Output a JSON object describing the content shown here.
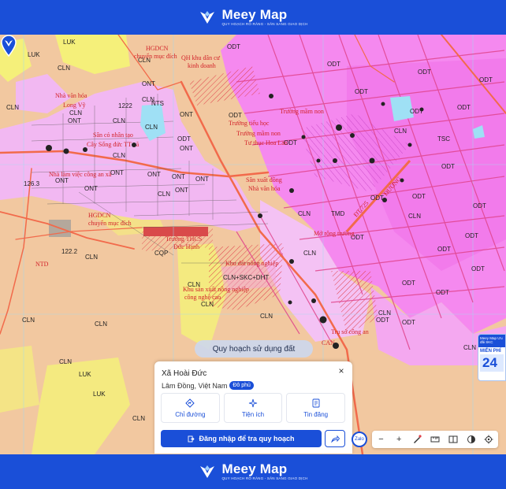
{
  "brand": {
    "name": "Meey Map",
    "tagline": "QUY HOẠCH RÕ RÀNG - SĂN SANG GIAO DỊCH"
  },
  "map": {
    "labels_black": [
      {
        "t": "LUK"
      },
      {
        "t": "ODT"
      },
      {
        "t": "CLN"
      },
      {
        "t": "LUK"
      },
      {
        "t": "CLN"
      },
      {
        "t": "CLN"
      },
      {
        "t": "ONT"
      },
      {
        "t": "CLN"
      },
      {
        "t": "ONT"
      },
      {
        "t": "CLN"
      },
      {
        "t": "ONT"
      },
      {
        "t": "CLN"
      },
      {
        "t": "NTS"
      },
      {
        "t": "ONT"
      },
      {
        "t": "CLN"
      },
      {
        "t": "ONT"
      },
      {
        "t": "ONT"
      },
      {
        "t": "ONT"
      },
      {
        "t": "ONT"
      },
      {
        "t": "ONT"
      },
      {
        "t": "CLN"
      },
      {
        "t": "ONT"
      },
      {
        "t": "ONT"
      },
      {
        "t": "ODT"
      },
      {
        "t": "CLN"
      },
      {
        "t": "CQP"
      },
      {
        "t": "CLN"
      },
      {
        "t": "CLN"
      },
      {
        "t": "CLN"
      },
      {
        "t": "CLN"
      },
      {
        "t": "CLN"
      },
      {
        "t": "LUK"
      },
      {
        "t": "LUK"
      },
      {
        "t": "CLN"
      },
      {
        "t": "CLN"
      },
      {
        "t": "CLN"
      },
      {
        "t": "ODT"
      },
      {
        "t": "ODT"
      },
      {
        "t": "ODT"
      },
      {
        "t": "ODT"
      },
      {
        "t": "ODT"
      },
      {
        "t": "ODT"
      },
      {
        "t": "ODT"
      },
      {
        "t": "ODT"
      },
      {
        "t": "CLN"
      },
      {
        "t": "TMD"
      },
      {
        "t": "ODT"
      },
      {
        "t": "CLN"
      },
      {
        "t": "ODT"
      },
      {
        "t": "ODT"
      },
      {
        "t": "TSC"
      },
      {
        "t": "ODT"
      },
      {
        "t": "CLN"
      },
      {
        "t": "ODT"
      },
      {
        "t": "ODT"
      },
      {
        "t": "ODT"
      },
      {
        "t": "CLN"
      },
      {
        "t": "ODT"
      },
      {
        "t": "ODT"
      },
      {
        "t": "CLN"
      },
      {
        "t": "ODT"
      },
      {
        "t": "ODT"
      },
      {
        "t": "ODT"
      },
      {
        "t": "CLN"
      },
      {
        "t": "CLN+SKC+DHT"
      },
      {
        "t": "122.2"
      },
      {
        "t": "126.3"
      },
      {
        "t": "1222"
      }
    ],
    "labels_red": [
      {
        "t": "HGDCN"
      },
      {
        "t": "chuyển mục đích"
      },
      {
        "t": "QH khu dân cư"
      },
      {
        "t": "kinh doanh"
      },
      {
        "t": "Nhà văn hóa"
      },
      {
        "t": "Long Vỹ"
      },
      {
        "t": "Sân cỏ nhân tạo"
      },
      {
        "t": "Cây Sống đức TT xã"
      },
      {
        "t": "Nhà làm việc công an xã"
      },
      {
        "t": "Trường mầm non"
      },
      {
        "t": "Trường tiểu học"
      },
      {
        "t": "Trường mầm non"
      },
      {
        "t": "Tư thục Hoa Lan"
      },
      {
        "t": "Sân xuất đồng"
      },
      {
        "t": "Nhà văn hóa"
      },
      {
        "t": "HGDCN"
      },
      {
        "t": "chuyển mục đích"
      },
      {
        "t": "Mở rộng trường"
      },
      {
        "t": "Trường THCS"
      },
      {
        "t": "Đức Hạnh"
      },
      {
        "t": "Khu đất nông nghiệp"
      },
      {
        "t": "Khu sản xuất nông nghiệp"
      },
      {
        "t": "công nghệ cao"
      },
      {
        "t": "Trụ sở công an"
      },
      {
        "t": "CAN"
      },
      {
        "t": "NTD"
      },
      {
        "t": "ĐT.725"
      },
      {
        "t": "ĐƯỜNG"
      }
    ]
  },
  "plan_button": "Quy hoạch sử dụng đất",
  "card": {
    "title": "Xã Hoài Đức",
    "subtitle": "Lâm Đồng, Việt Nam",
    "badge": "Đô phủ",
    "actions": [
      {
        "label": "Chỉ đường",
        "icon": "directions-icon"
      },
      {
        "label": "Tiện ích",
        "icon": "utilities-icon"
      },
      {
        "label": "Tin đăng",
        "icon": "listings-icon"
      }
    ],
    "login_label": "Đăng nhập để tra quy hoạch",
    "close": "×"
  },
  "zalo": "Zalo",
  "promo": {
    "head": "Meey Map\nƯu đãi SKC",
    "label": "MIỄN PHÍ",
    "number": "24"
  },
  "colors": {
    "brand": "#1a4fd8",
    "odt": "#f589ef",
    "ont": "#f2b8f2",
    "cln": "#f2c8a0",
    "luk": "#f5f07a",
    "road": "#f26a4b"
  }
}
